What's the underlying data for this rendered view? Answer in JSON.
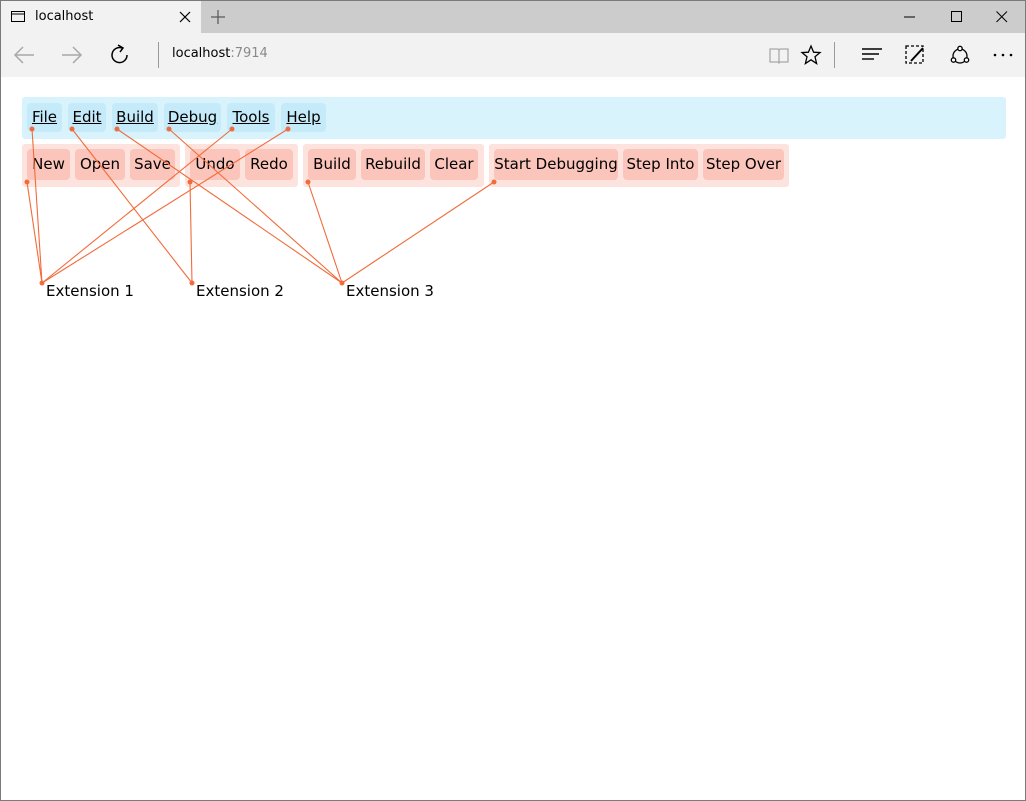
{
  "browser": {
    "tab_title": "localhost",
    "url_host": "localhost",
    "url_port": ":7914"
  },
  "menu": {
    "items": [
      {
        "label": "File"
      },
      {
        "label": "Edit"
      },
      {
        "label": "Build"
      },
      {
        "label": "Debug"
      },
      {
        "label": "Tools"
      },
      {
        "label": "Help"
      }
    ]
  },
  "toolbar": {
    "groups": [
      {
        "buttons": [
          "New",
          "Open",
          "Save"
        ]
      },
      {
        "buttons": [
          "Undo",
          "Redo"
        ]
      },
      {
        "buttons": [
          "Build",
          "Rebuild",
          "Clear"
        ]
      },
      {
        "buttons": [
          "Start Debugging",
          "Step Into",
          "Step Over"
        ]
      }
    ]
  },
  "extensions": [
    {
      "label": "Extension 1"
    },
    {
      "label": "Extension 2"
    },
    {
      "label": "Extension 3"
    }
  ],
  "colors": {
    "menubar_bg": "#d9f3fd",
    "menu_item_bg": "#c5ebfa",
    "toolbar_group_bg": "#fde3de",
    "toolbar_button_bg": "#fbc5bb",
    "link_line": "#f26b3a"
  },
  "icons": {
    "tab": "browser-tab-icon",
    "back": "back-arrow-icon",
    "forward": "forward-arrow-icon",
    "refresh": "refresh-icon",
    "reading_view": "reading-view-icon",
    "favorite": "star-icon",
    "hub": "hub-icon",
    "notes": "web-note-icon",
    "share": "share-icon",
    "more": "more-icon"
  }
}
